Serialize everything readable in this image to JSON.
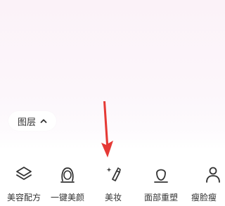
{
  "layers_button": {
    "label": "图层",
    "icon": "chevron-up-icon"
  },
  "annotation": {
    "icon": "red-arrow",
    "color": "#e53935"
  },
  "toolbar": {
    "items": [
      {
        "label": "美容配方",
        "icon": "layers-stack-icon"
      },
      {
        "label": "一键美颜",
        "icon": "face-outline-icon"
      },
      {
        "label": "美妆",
        "icon": "lipstick-sparkle-icon"
      },
      {
        "label": "面部重塑",
        "icon": "face-reshape-icon"
      },
      {
        "label": "瘦脸瘦",
        "icon": "body-reshape-icon"
      }
    ]
  },
  "colors": {
    "background_top": "#fbf2f8",
    "background_bottom": "#ffffff",
    "icon": "#333333",
    "text": "#333333"
  }
}
